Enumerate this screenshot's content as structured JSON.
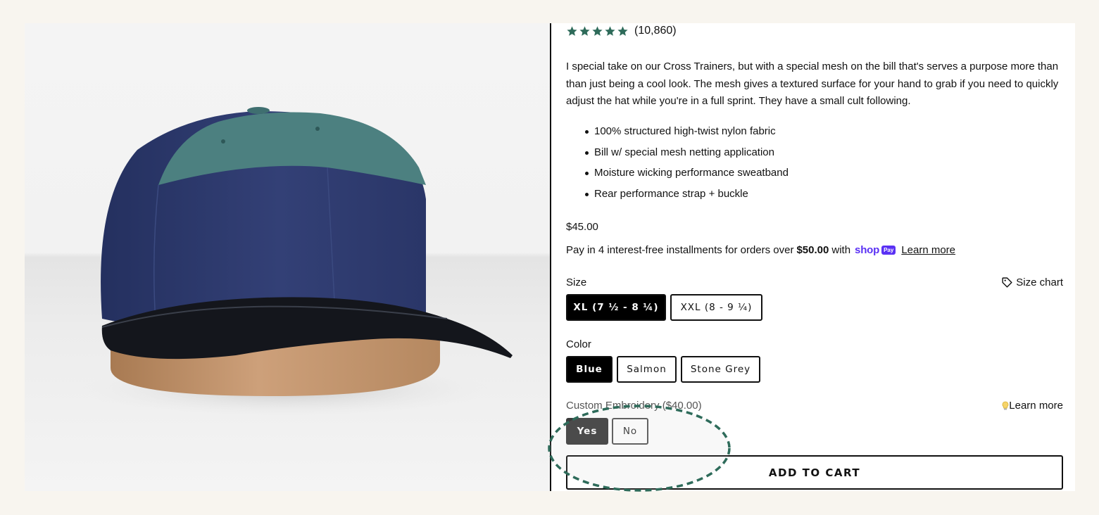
{
  "product_image": {
    "name": "hat-photo"
  },
  "rating": {
    "stars": 5,
    "count_text": "(10,860)",
    "star_color": "#2e6b5a"
  },
  "description": "I special take on our Cross Trainers, but with a special mesh on the bill that's serves a purpose more than than just being a cool look. The mesh gives a textured surface for your hand to grab if you need to quickly adjust the hat while you're in a full sprint. They have a small cult following.",
  "features": [
    "100% structured high-twist nylon fabric",
    "Bill w/ special mesh netting application",
    "Moisture wicking performance sweatband",
    "Rear performance strap + buckle"
  ],
  "price": "$45.00",
  "installments": {
    "text": "Pay in 4 interest-free installments for orders over",
    "amount": "$50.00",
    "with": "with",
    "shop_logo": "shop",
    "pay_badge": "Pay",
    "learn_more": "Learn more"
  },
  "size": {
    "label": "Size",
    "chart_label": "Size chart",
    "chart_icon": "tag-icon",
    "options": [
      "XL (7 ½ - 8 ¼)",
      "XXL (8 - 9 ¼)"
    ],
    "selected": "XL (7 ½ - 8 ¼)"
  },
  "color": {
    "label": "Color",
    "options": [
      "Blue",
      "Salmon",
      "Stone Grey"
    ],
    "selected": "Blue"
  },
  "embroidery": {
    "label": "Custom Embroidery ($40.00)",
    "learn_more": "Learn more",
    "learn_icon": "lightbulb-icon",
    "options": [
      "Yes",
      "No"
    ],
    "selected": "Yes",
    "highlight_color": "#2e6b5a"
  },
  "add_to_cart": "ADD TO CART"
}
